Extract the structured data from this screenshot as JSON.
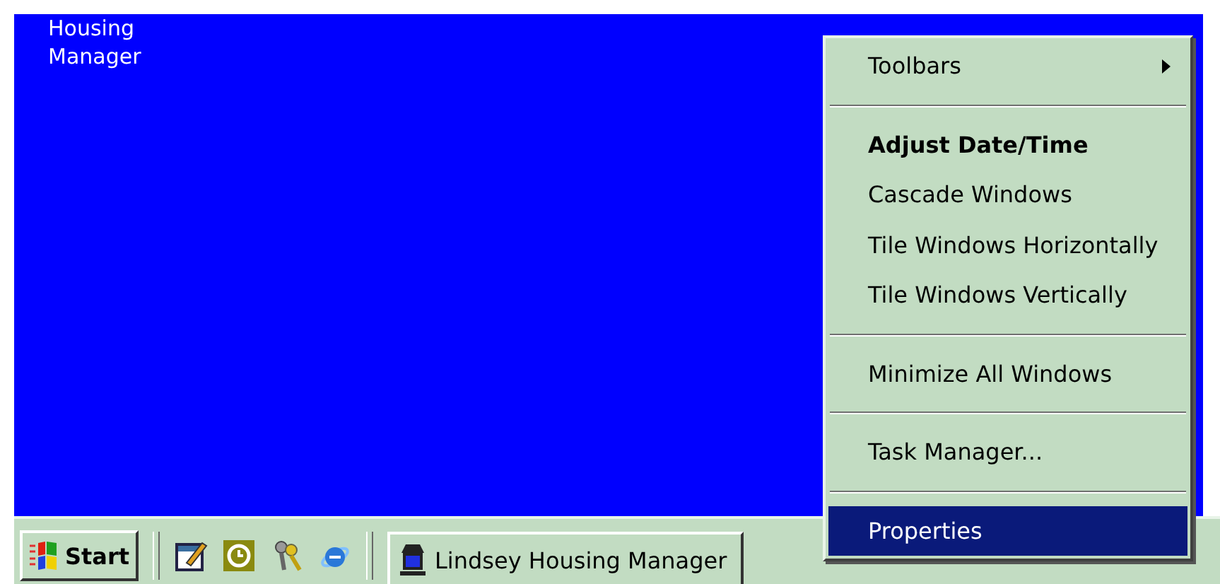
{
  "desktop": {
    "icon_label": "Housing Manager"
  },
  "context_menu": {
    "items": [
      {
        "kind": "item",
        "label": "Toolbars",
        "submenu": true,
        "default": false,
        "selected": false
      },
      {
        "kind": "separator"
      },
      {
        "kind": "item",
        "label": "Adjust Date/Time",
        "submenu": false,
        "default": true,
        "selected": false
      },
      {
        "kind": "item",
        "label": "Cascade Windows",
        "submenu": false,
        "default": false,
        "selected": false
      },
      {
        "kind": "item",
        "label": "Tile Windows Horizontally",
        "submenu": false,
        "default": false,
        "selected": false
      },
      {
        "kind": "item",
        "label": "Tile Windows Vertically",
        "submenu": false,
        "default": false,
        "selected": false
      },
      {
        "kind": "separator"
      },
      {
        "kind": "item",
        "label": "Minimize All Windows",
        "submenu": false,
        "default": false,
        "selected": false
      },
      {
        "kind": "separator"
      },
      {
        "kind": "item",
        "label": "Task Manager...",
        "submenu": false,
        "default": false,
        "selected": false
      },
      {
        "kind": "separator"
      },
      {
        "kind": "item",
        "label": "Properties",
        "submenu": false,
        "default": false,
        "selected": true
      }
    ]
  },
  "taskbar": {
    "start_label": "Start",
    "quick_launch": [
      {
        "kind": "notepad"
      },
      {
        "kind": "clock"
      },
      {
        "kind": "keys"
      },
      {
        "kind": "browser"
      }
    ],
    "tasks": [
      {
        "label": "Lindsey Housing Manager",
        "selected": false
      }
    ]
  }
}
